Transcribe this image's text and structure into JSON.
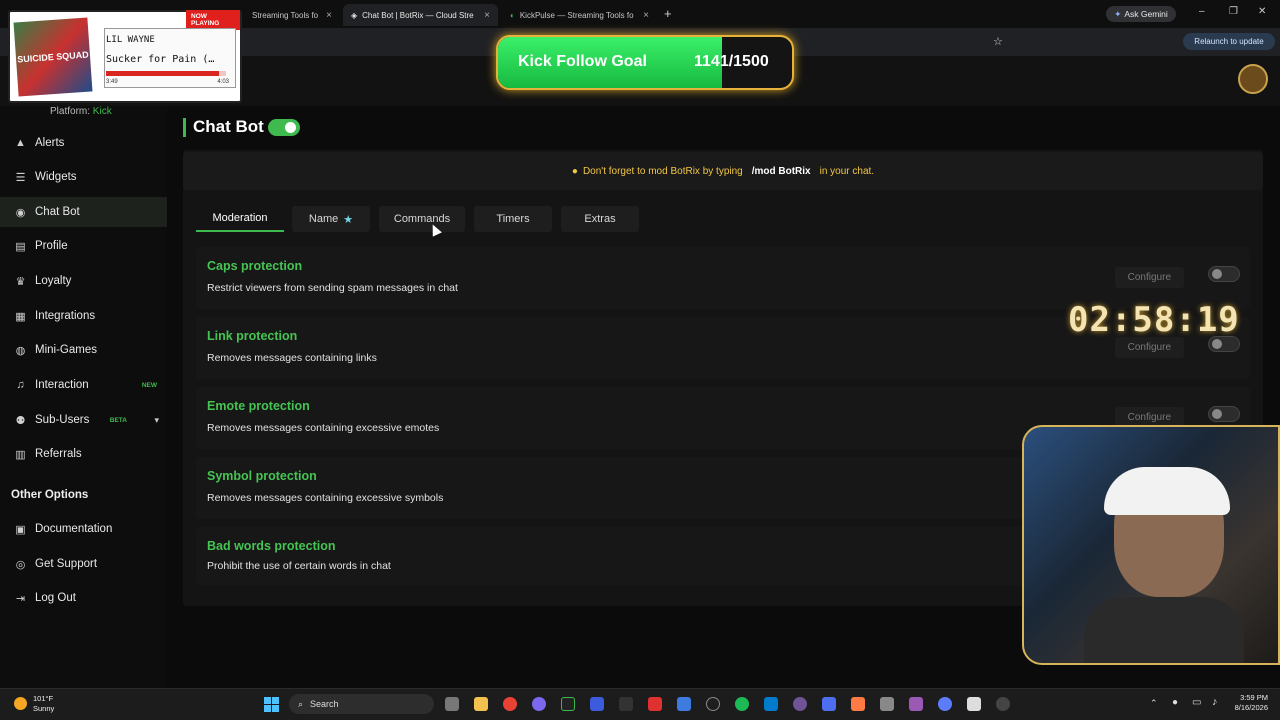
{
  "browser": {
    "tabs": [
      {
        "label": "Streaming Tools fo",
        "active": false
      },
      {
        "label": "Chat Bot | BotRix — Cloud Stre",
        "active": true
      },
      {
        "label": "KickPulse — Streaming Tools fo",
        "active": false
      }
    ],
    "gemini_label": "Ask Gemini",
    "relaunch_label": "Relaunch to update"
  },
  "now_playing": {
    "badge": "NOW PLAYING",
    "album_text": "SUICIDE SQUAD",
    "artist": "LIL WAYNE",
    "track": "Sucker for Pain (…",
    "elapsed": "3:49",
    "duration": "4:03",
    "progress": 0.94
  },
  "goal": {
    "title": "Kick Follow Goal",
    "count": "1141/1500",
    "current": 1141,
    "target": 1500
  },
  "timer": "02:58:19",
  "sidebar": {
    "platform_label": "Platform:",
    "platform_value": "Kick",
    "items": [
      {
        "label": "Alerts",
        "icon": "warning-icon"
      },
      {
        "label": "Widgets",
        "icon": "list-icon"
      },
      {
        "label": "Chat Bot",
        "icon": "robot-icon",
        "active": true
      },
      {
        "label": "Profile",
        "icon": "profile-icon"
      },
      {
        "label": "Loyalty",
        "icon": "trophy-icon"
      },
      {
        "label": "Integrations",
        "icon": "integrations-icon"
      },
      {
        "label": "Mini-Games",
        "icon": "gamepad-icon"
      },
      {
        "label": "Interaction",
        "icon": "music-icon",
        "badge": "NEW"
      },
      {
        "label": "Sub-Users",
        "icon": "users-icon",
        "badge": "BETA"
      },
      {
        "label": "Referrals",
        "icon": "referrals-icon"
      }
    ],
    "other_heading": "Other Options",
    "other_items": [
      {
        "label": "Documentation",
        "icon": "docs-icon"
      },
      {
        "label": "Get Support",
        "icon": "support-icon"
      },
      {
        "label": "Log Out",
        "icon": "logout-icon"
      }
    ]
  },
  "page": {
    "title": "Chat Bot",
    "notice_pre": "Don't forget to mod BotRix by typing",
    "notice_cmd": "/mod BotRix",
    "notice_post": "in your chat.",
    "tabs": [
      "Moderation",
      "Name",
      "Commands",
      "Timers",
      "Extras"
    ],
    "configure_label": "Configure",
    "rows": [
      {
        "title": "Caps protection",
        "desc": "Restrict viewers from sending spam messages in chat"
      },
      {
        "title": "Link protection",
        "desc": "Removes messages containing links"
      },
      {
        "title": "Emote protection",
        "desc": "Removes messages containing excessive emotes"
      },
      {
        "title": "Symbol protection",
        "desc": "Removes messages containing excessive symbols"
      },
      {
        "title": "Bad words protection",
        "desc": "Prohibit the use of certain words in chat"
      }
    ]
  },
  "taskbar": {
    "weather_temp": "101°F",
    "weather_desc": "Sunny",
    "search_label": "Search",
    "time": "3:59 PM",
    "date": "8/16/2026"
  },
  "colors": {
    "accent": "#3fba4f",
    "notice": "#f2c744",
    "goal_border": "#e6b23a"
  }
}
